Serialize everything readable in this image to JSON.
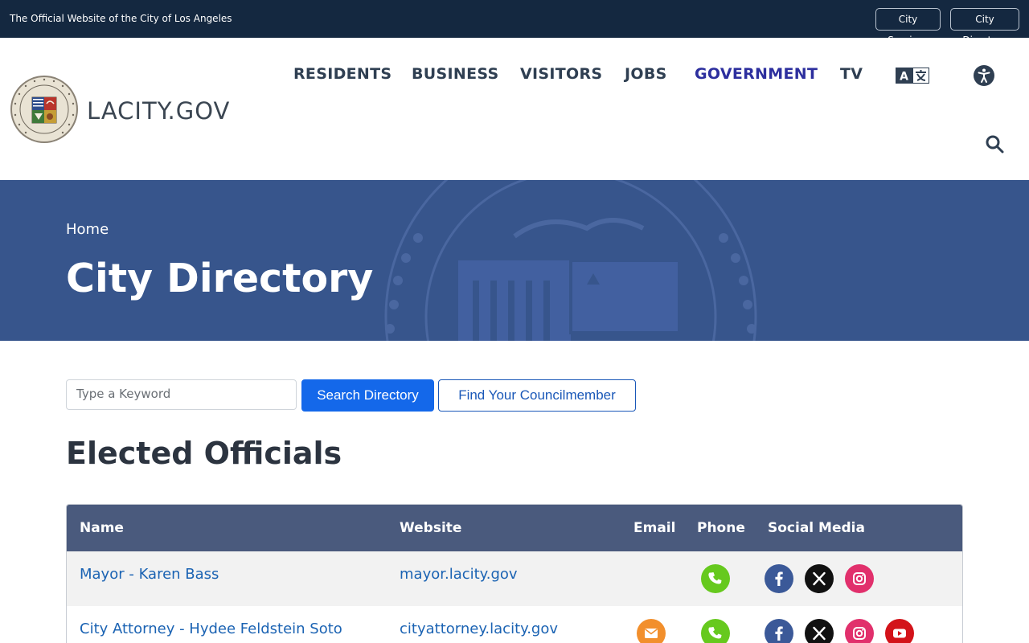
{
  "topbar": {
    "official_text": "The Official Website of the City of Los Angeles",
    "city_services": "City Services",
    "city_directory": "City Directory"
  },
  "header": {
    "brand": "LACITY.GOV",
    "nav": [
      "RESIDENTS",
      "BUSINESS",
      "VISITORS",
      "JOBS",
      "GOVERNMENT",
      "TV"
    ],
    "active_nav": "GOVERNMENT"
  },
  "hero": {
    "breadcrumb": "Home",
    "title": "City Directory"
  },
  "search": {
    "placeholder": "Type a Keyword",
    "search_button": "Search Directory",
    "council_button": "Find Your Councilmember"
  },
  "section": {
    "title": "Elected Officials"
  },
  "table": {
    "headers": [
      "Name",
      "Website",
      "Email",
      "Phone",
      "Social Media"
    ],
    "rows": [
      {
        "name": "Mayor - Karen Bass",
        "website": "mayor.lacity.gov",
        "email": false,
        "phone": true,
        "social": [
          "facebook",
          "x",
          "instagram"
        ]
      },
      {
        "name": "City Attorney - Hydee Feldstein Soto",
        "website": "cityattorney.lacity.gov",
        "email": true,
        "phone": true,
        "social": [
          "facebook",
          "x",
          "instagram",
          "youtube"
        ]
      }
    ]
  },
  "colors": {
    "topbar_bg": "#142840",
    "hero_bg": "#37558c",
    "active_nav": "#2d2f9e",
    "primary_button": "#1468ea",
    "table_header": "#4a5a7d",
    "link": "#1b63b3",
    "phone_green": "#66c91e",
    "email_orange": "#f28f2c",
    "facebook": "#3b5998",
    "x_black": "#111111",
    "instagram": "#e1306c",
    "youtube": "#d3131a"
  }
}
